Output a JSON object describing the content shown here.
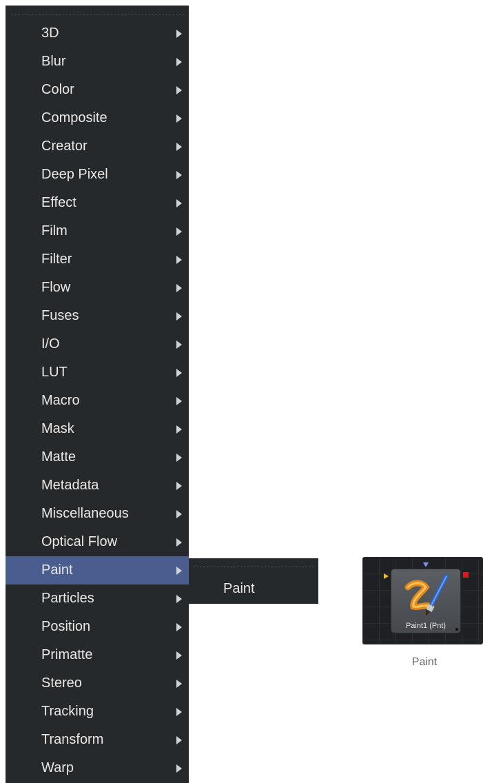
{
  "menu": {
    "items": [
      {
        "label": "3D"
      },
      {
        "label": "Blur"
      },
      {
        "label": "Color"
      },
      {
        "label": "Composite"
      },
      {
        "label": "Creator"
      },
      {
        "label": "Deep Pixel"
      },
      {
        "label": "Effect"
      },
      {
        "label": "Film"
      },
      {
        "label": "Filter"
      },
      {
        "label": "Flow"
      },
      {
        "label": "Fuses"
      },
      {
        "label": "I/O"
      },
      {
        "label": "LUT"
      },
      {
        "label": "Macro"
      },
      {
        "label": "Mask"
      },
      {
        "label": "Matte"
      },
      {
        "label": "Metadata"
      },
      {
        "label": "Miscellaneous"
      },
      {
        "label": "Optical Flow"
      },
      {
        "label": "Paint",
        "active": true
      },
      {
        "label": "Particles"
      },
      {
        "label": "Position"
      },
      {
        "label": "Primatte"
      },
      {
        "label": "Stereo"
      },
      {
        "label": "Tracking"
      },
      {
        "label": "Transform"
      },
      {
        "label": "Warp"
      }
    ],
    "submenu_arrow_icon": "chevron-right-icon",
    "colors": {
      "background": "#26292c",
      "highlight": "#4a5d8f",
      "text": "#e8e8e8"
    }
  },
  "submenu": {
    "items": [
      {
        "label": "Paint"
      }
    ]
  },
  "node": {
    "label": "Paint1  (Pnt)",
    "icon": "paint-brush-icon",
    "colors": {
      "input": "#f0c11e",
      "mask_input": "#8a8fe8",
      "output": "#d11f1f"
    }
  },
  "caption": "Paint"
}
